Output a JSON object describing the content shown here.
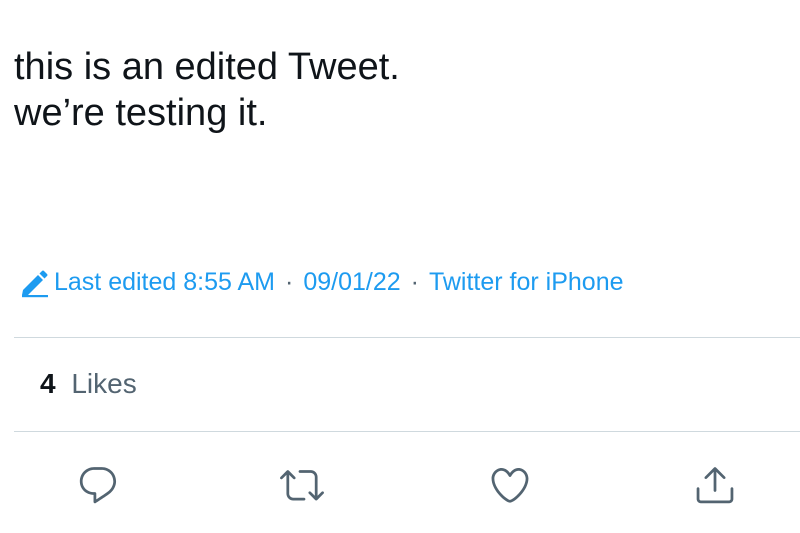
{
  "tweet": {
    "lines": [
      "this is an edited Tweet.",
      "we’re testing it."
    ]
  },
  "meta": {
    "edited_icon": "pencil-icon",
    "edited_label": "Last edited 8:55 AM",
    "separator": "·",
    "date": "09/01/22",
    "source": "Twitter for iPhone",
    "accent_color": "#1d9bf0"
  },
  "stats": {
    "likes_count": "4",
    "likes_label": "Likes"
  },
  "actions": {
    "icons": [
      "reply-icon",
      "retweet-icon",
      "like-icon",
      "share-icon"
    ],
    "icon_color": "#536471"
  }
}
